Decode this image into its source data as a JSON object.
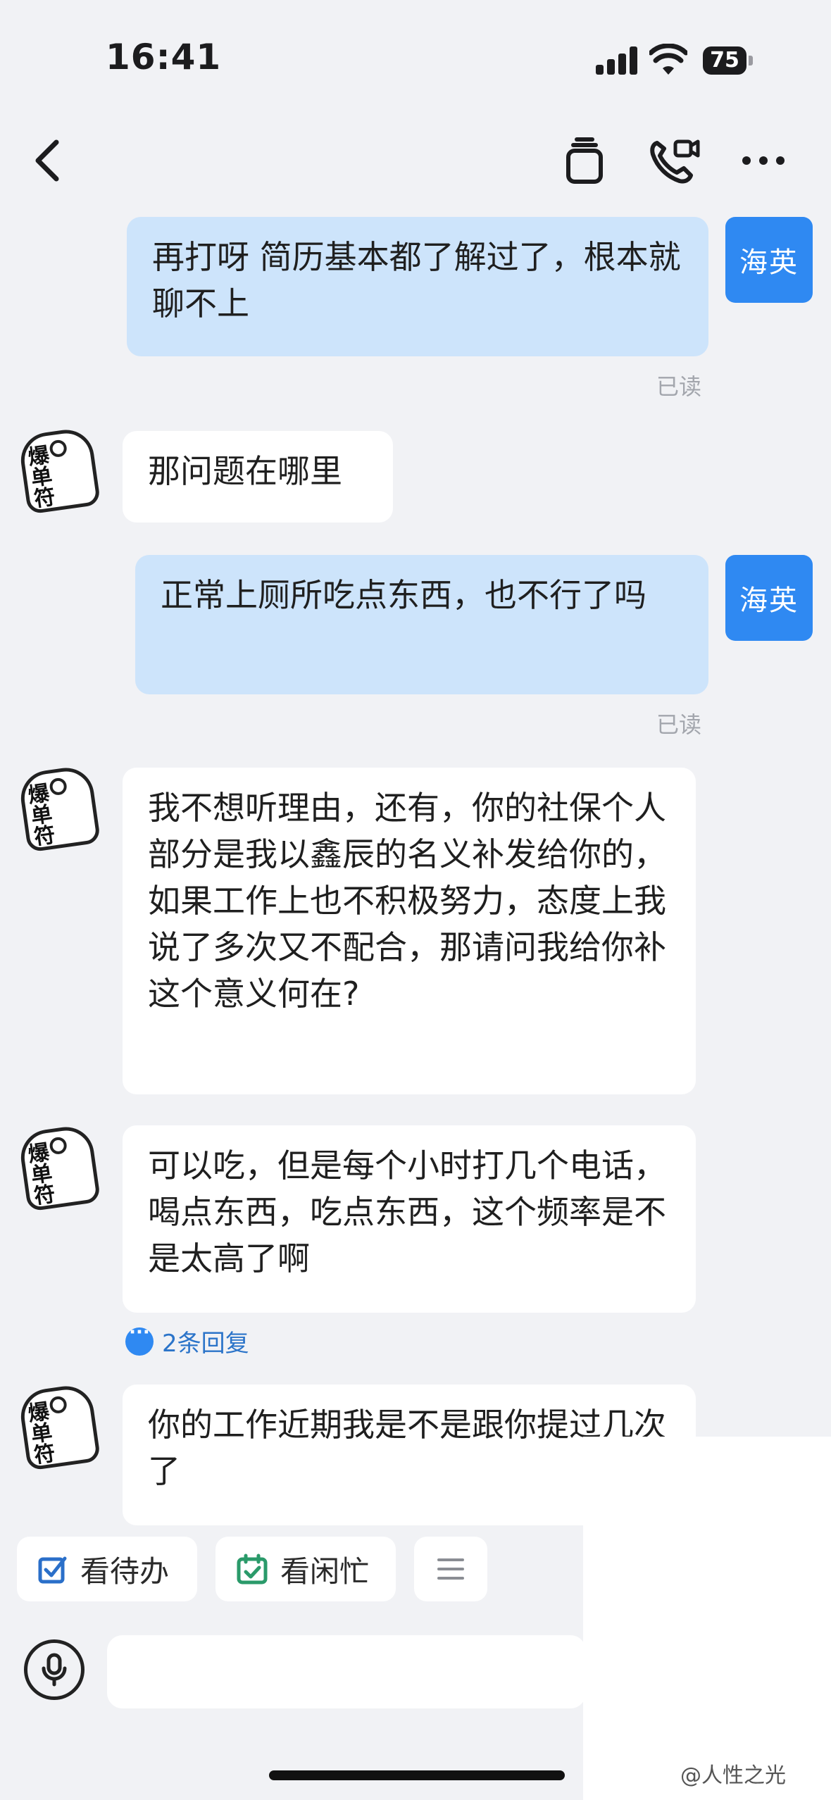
{
  "status_bar": {
    "time": "16:41",
    "battery": "75"
  },
  "messages": [
    {
      "side": "out",
      "text": "再打呀 简历基本都了解过了，根本就聊不上",
      "sender": "海英",
      "status": "已读"
    },
    {
      "side": "in",
      "text": "那问题在哪里"
    },
    {
      "side": "out",
      "text": "正常上厕所吃点东西，也不行了吗",
      "sender": "海英",
      "status": "已读"
    },
    {
      "side": "in",
      "text": "我不想听理由，还有，你的社保个人部分是我以鑫辰的名义补发给你的，如果工作上也不积极努力，态度上我说了多次又不配合，那请问我给你补这个意义何在?"
    },
    {
      "side": "in",
      "text": "可以吃，但是每个小时打几个电话，喝点东西，吃点东西，这个频率是不是太高了啊",
      "replies": "2条回复"
    },
    {
      "side": "in",
      "text": "你的工作近期我是不是跟你提过几次了"
    }
  ],
  "sender_avatar": {
    "chars": [
      "爆",
      "单",
      "符"
    ]
  },
  "toolbar": {
    "todo_label": "看待办",
    "busy_label": "看闲忙",
    "menu_icon": "menu-lines-icon"
  },
  "input": {
    "placeholder": ""
  },
  "watermark": "@人性之光",
  "colors": {
    "accent": "#2f89f2",
    "outgoing_bubble": "#cde4fb",
    "incoming_bubble": "#ffffff",
    "background": "#f1f2f5",
    "reply_link": "#2b74c9"
  }
}
